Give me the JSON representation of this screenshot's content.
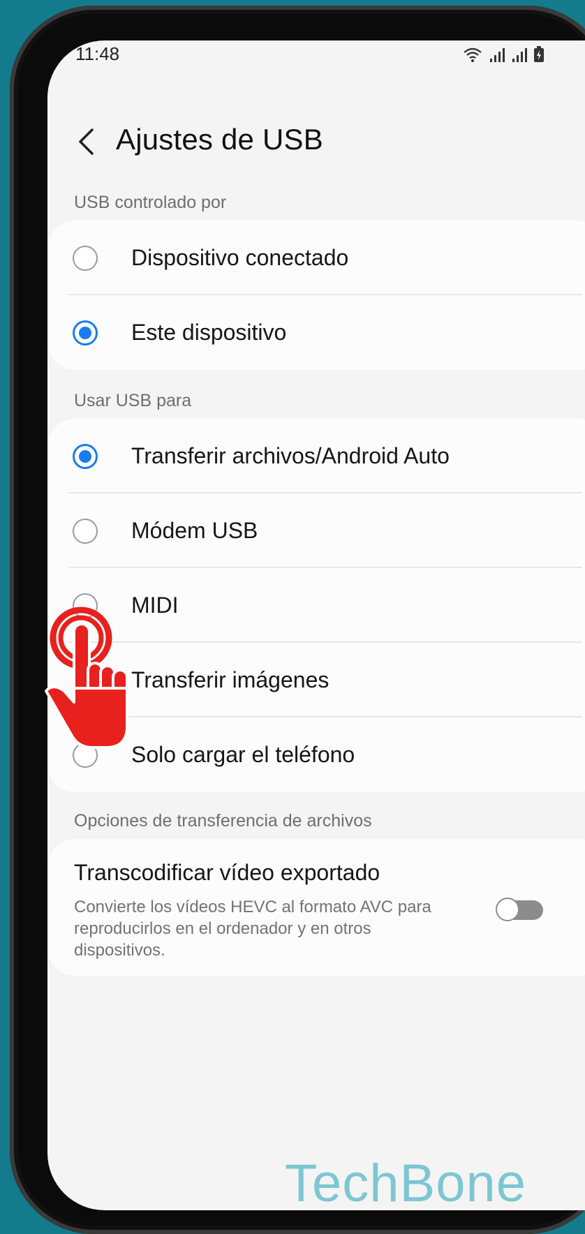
{
  "status": {
    "time": "11:48"
  },
  "header": {
    "title": "Ajustes de USB"
  },
  "sections": {
    "controlled_by": {
      "label": "USB controlado por",
      "options": [
        {
          "label": "Dispositivo conectado",
          "selected": false
        },
        {
          "label": "Este dispositivo",
          "selected": true
        }
      ]
    },
    "use_usb_for": {
      "label": "Usar USB para",
      "options": [
        {
          "label": "Transferir archivos/Android Auto",
          "selected": true
        },
        {
          "label": "Módem USB",
          "selected": false
        },
        {
          "label": "MIDI",
          "selected": false
        },
        {
          "label": "Transferir imágenes",
          "selected": false
        },
        {
          "label": "Solo cargar el teléfono",
          "selected": false
        }
      ]
    },
    "file_transfer": {
      "label": "Opciones de transferencia de archivos",
      "transcode": {
        "title": "Transcodificar vídeo exportado",
        "description": "Convierte los vídeos HEVC al formato AVC para reproducirlos en el ordenador y en otros dispositivos.",
        "enabled": false
      }
    }
  },
  "watermark": "TechBone",
  "colors": {
    "accent": "#1a7cf0",
    "background": "#137b8c",
    "tap_hand": "#e8201e"
  },
  "icons": [
    "back-arrow-icon",
    "wifi-icon",
    "signal-icon",
    "battery-icon",
    "tap-hand-icon"
  ]
}
